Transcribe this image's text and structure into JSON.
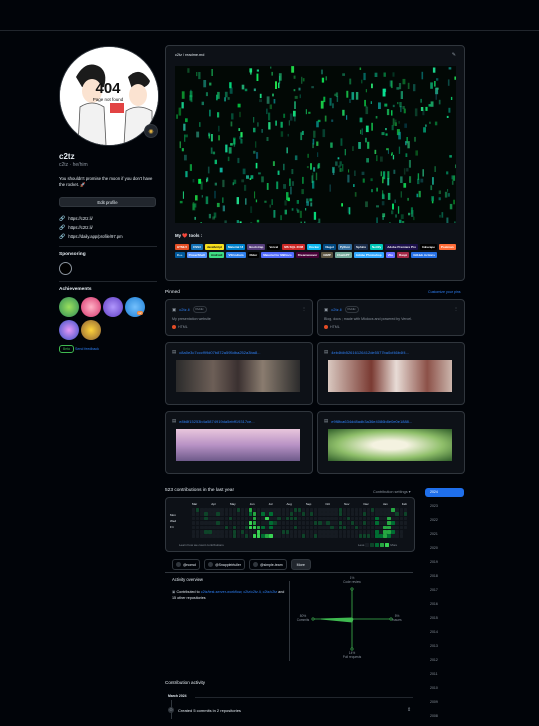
{
  "profile": {
    "name": "c2tz",
    "handle": "c2tz · he/him",
    "bio": "You shouldn't promise the moon if you don't have the rocket. 🚀",
    "edit_label": "Edit profile",
    "avatar_text": "404",
    "avatar_sub": "Page not found",
    "links": [
      "https://c2tz.li/",
      "https://c2tz.li/",
      "https://daily.app/profile/97.pm"
    ]
  },
  "sponsoring": {
    "title": "Sponsoring"
  },
  "achievements": {
    "title": "Achievements",
    "badge_x": "x2",
    "beta": "Beta",
    "feedback": "Send feedback"
  },
  "readme": {
    "path": "c2tz / readme.md",
    "tools_title": "My ❤️ tools :",
    "badges": [
      {
        "t": "HTML5",
        "c": "#e34f26"
      },
      {
        "t": "CSS3",
        "c": "#1572b6"
      },
      {
        "t": "JavaScript",
        "c": "#f7df1e"
      },
      {
        "t": "Material UI",
        "c": "#0081cb"
      },
      {
        "t": "Bootstrap",
        "c": "#563d7c"
      },
      {
        "t": "Vercel",
        "c": "#000000"
      },
      {
        "t": "MS SQL 2008",
        "c": "#cc2927"
      },
      {
        "t": "Docker",
        "c": "#0db7ed"
      },
      {
        "t": "Nuget",
        "c": "#004880"
      },
      {
        "t": "Python",
        "c": "#3670a0"
      },
      {
        "t": "Sphinx",
        "c": "#1a2c4a"
      },
      {
        "t": "Netlify",
        "c": "#00c7b7"
      },
      {
        "t": "Adobe Premiere Pro",
        "c": "#1b0f4a"
      },
      {
        "t": "Inkscape",
        "c": "#000000"
      },
      {
        "t": "Postman",
        "c": "#ff6c37"
      },
      {
        "t": "C++",
        "c": "#00599c"
      },
      {
        "t": "PowerShell",
        "c": "#5391fe"
      },
      {
        "t": "Android",
        "c": "#3ddc84"
      },
      {
        "t": "VSCodium",
        "c": "#2f80ed"
      },
      {
        "t": "Rider",
        "c": "#000000"
      },
      {
        "t": "Material for MkDocs",
        "c": "#526cfe"
      },
      {
        "t": "Dreamweaver",
        "c": "#470137"
      },
      {
        "t": "GIMP",
        "c": "#5c5543"
      },
      {
        "t": "ChatGPT",
        "c": "#74aa9c"
      },
      {
        "t": "Adobe Photoshop",
        "c": "#31a8ff"
      },
      {
        "t": "Vite",
        "c": "#646cff"
      },
      {
        "t": "Raspi",
        "c": "#a22846"
      },
      {
        "t": "GitHub Actions",
        "c": "#2671e5"
      }
    ]
  },
  "pinned": {
    "title": "Pinned",
    "customize": "Customize your pins",
    "cards": [
      {
        "name": "c2tz.li",
        "vis": "Public",
        "desc": "My presentation website",
        "lang": "HTML"
      },
      {
        "name": "c2tz.li",
        "vis": "Public",
        "desc": "Blog, docs ; made with Mkdocs and powered by Vercel.",
        "lang": "HTML"
      },
      {
        "name": "c8a0e3c7cccf99d07b872a595dba252a3ba8..."
      },
      {
        "name": "4eb4fdb52616126412de5577ba0cf46b4f4..."
      },
      {
        "name": "e8b8f15253b4a5874919da5ebff19317ce..."
      },
      {
        "name": "e9f8fca634dd8adb3a36e4086b8e0e0e1888..."
      }
    ]
  },
  "contributions": {
    "title": "523 contributions in the last year",
    "settings": "Contribution settings ▾",
    "months": [
      "Mar",
      "Apr",
      "May",
      "Jun",
      "Jul",
      "Aug",
      "Sep",
      "Oct",
      "Nov",
      "Dec",
      "Jan",
      "Feb"
    ],
    "days": [
      "Mon",
      "Wed",
      "Fri"
    ],
    "learn": "Learn how we count contributions",
    "less": "Less",
    "more": "More"
  },
  "orgs": {
    "chips": [
      "@nomol",
      "@Snappleirtuller",
      "@simple-team"
    ],
    "more": "More"
  },
  "overview": {
    "title": "Activity overview",
    "contributed_prefix": "Contributed to ",
    "repos": "c2tz/test-server-workflow, c2tz/c2tz.li, c2tz/c2tz",
    "suffix": " and 15 other repositories",
    "radar": {
      "code_review": {
        "pct": "1%",
        "label": "Code review"
      },
      "issues": {
        "pct": "5%",
        "label": "Issues"
      },
      "pull_requests": {
        "pct": "14%",
        "label": "Pull requests"
      },
      "commits": {
        "pct": "80%",
        "label": "Commits"
      }
    }
  },
  "activity": {
    "title": "Contribution activity",
    "month": "March 2024",
    "item": "Created 5 commits in 2 repositories"
  },
  "years": [
    "2024",
    "2023",
    "2022",
    "2021",
    "2020",
    "2019",
    "2018",
    "2017",
    "2016",
    "2015",
    "2014",
    "2013",
    "2012",
    "2011",
    "2010",
    "2009",
    "2008"
  ]
}
